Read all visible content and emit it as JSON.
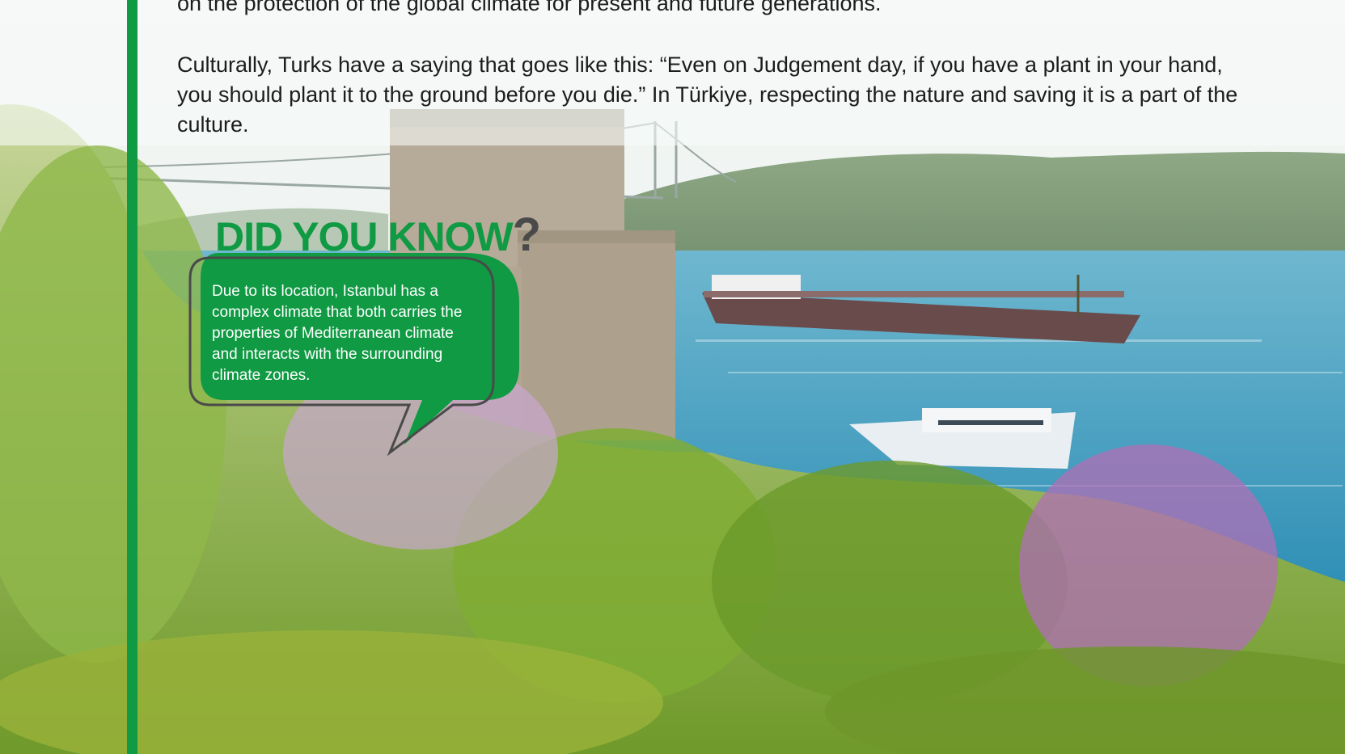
{
  "body": {
    "paragraph_1": "on the protection of the global climate for present and future generations.",
    "paragraph_2": "Culturally, Turks have a saying that goes like this: “Even on Judgement day, if you have a plant in your hand, you should plant it to the ground before you die.” In Türkiye, respecting the nature and saving it is a part of the culture."
  },
  "did_you_know": {
    "title": "DID YOU KNOW",
    "mark": "?",
    "text": "Due to its location, Istanbul has a complex climate that both carries the properties of Mediterranean climate and interacts with the surrounding climate zones."
  },
  "colors": {
    "accent_green": "#0f9a43",
    "outline_grey": "#4a4a4a"
  },
  "icons": [
    "speech-bubble-icon"
  ]
}
